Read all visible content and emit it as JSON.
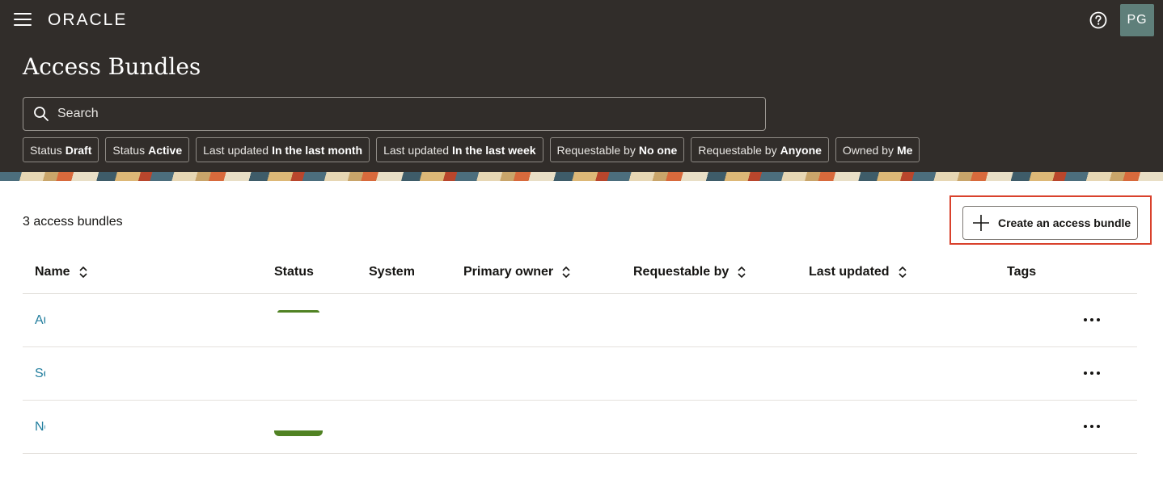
{
  "header": {
    "logo_text": "ORACLE",
    "title": "Access Bundles",
    "avatar_initials": "PG"
  },
  "search": {
    "placeholder": "Search"
  },
  "filters": [
    {
      "key": "Status",
      "value": "Draft"
    },
    {
      "key": "Status",
      "value": "Active"
    },
    {
      "key": "Last updated",
      "value": "In the last month"
    },
    {
      "key": "Last updated",
      "value": "In the last week"
    },
    {
      "key": "Requestable by",
      "value": "No one"
    },
    {
      "key": "Requestable by",
      "value": "Anyone"
    },
    {
      "key": "Owned by",
      "value": "Me"
    }
  ],
  "content": {
    "count_label": "3 access bundles",
    "create_button_label": "Create an access bundle"
  },
  "table": {
    "columns": {
      "name": "Name",
      "status": "Status",
      "system": "System",
      "primary_owner": "Primary owner",
      "requestable_by": "Requestable by",
      "last_updated": "Last updated",
      "tags": "Tags"
    },
    "rows": [
      {
        "name": "Au"
      },
      {
        "name": "Sc"
      },
      {
        "name": "Ne"
      }
    ]
  },
  "colors": {
    "header_bg": "#312d2a",
    "link": "#227e9e",
    "highlight": "#d9412c",
    "status_active": "#508223"
  }
}
